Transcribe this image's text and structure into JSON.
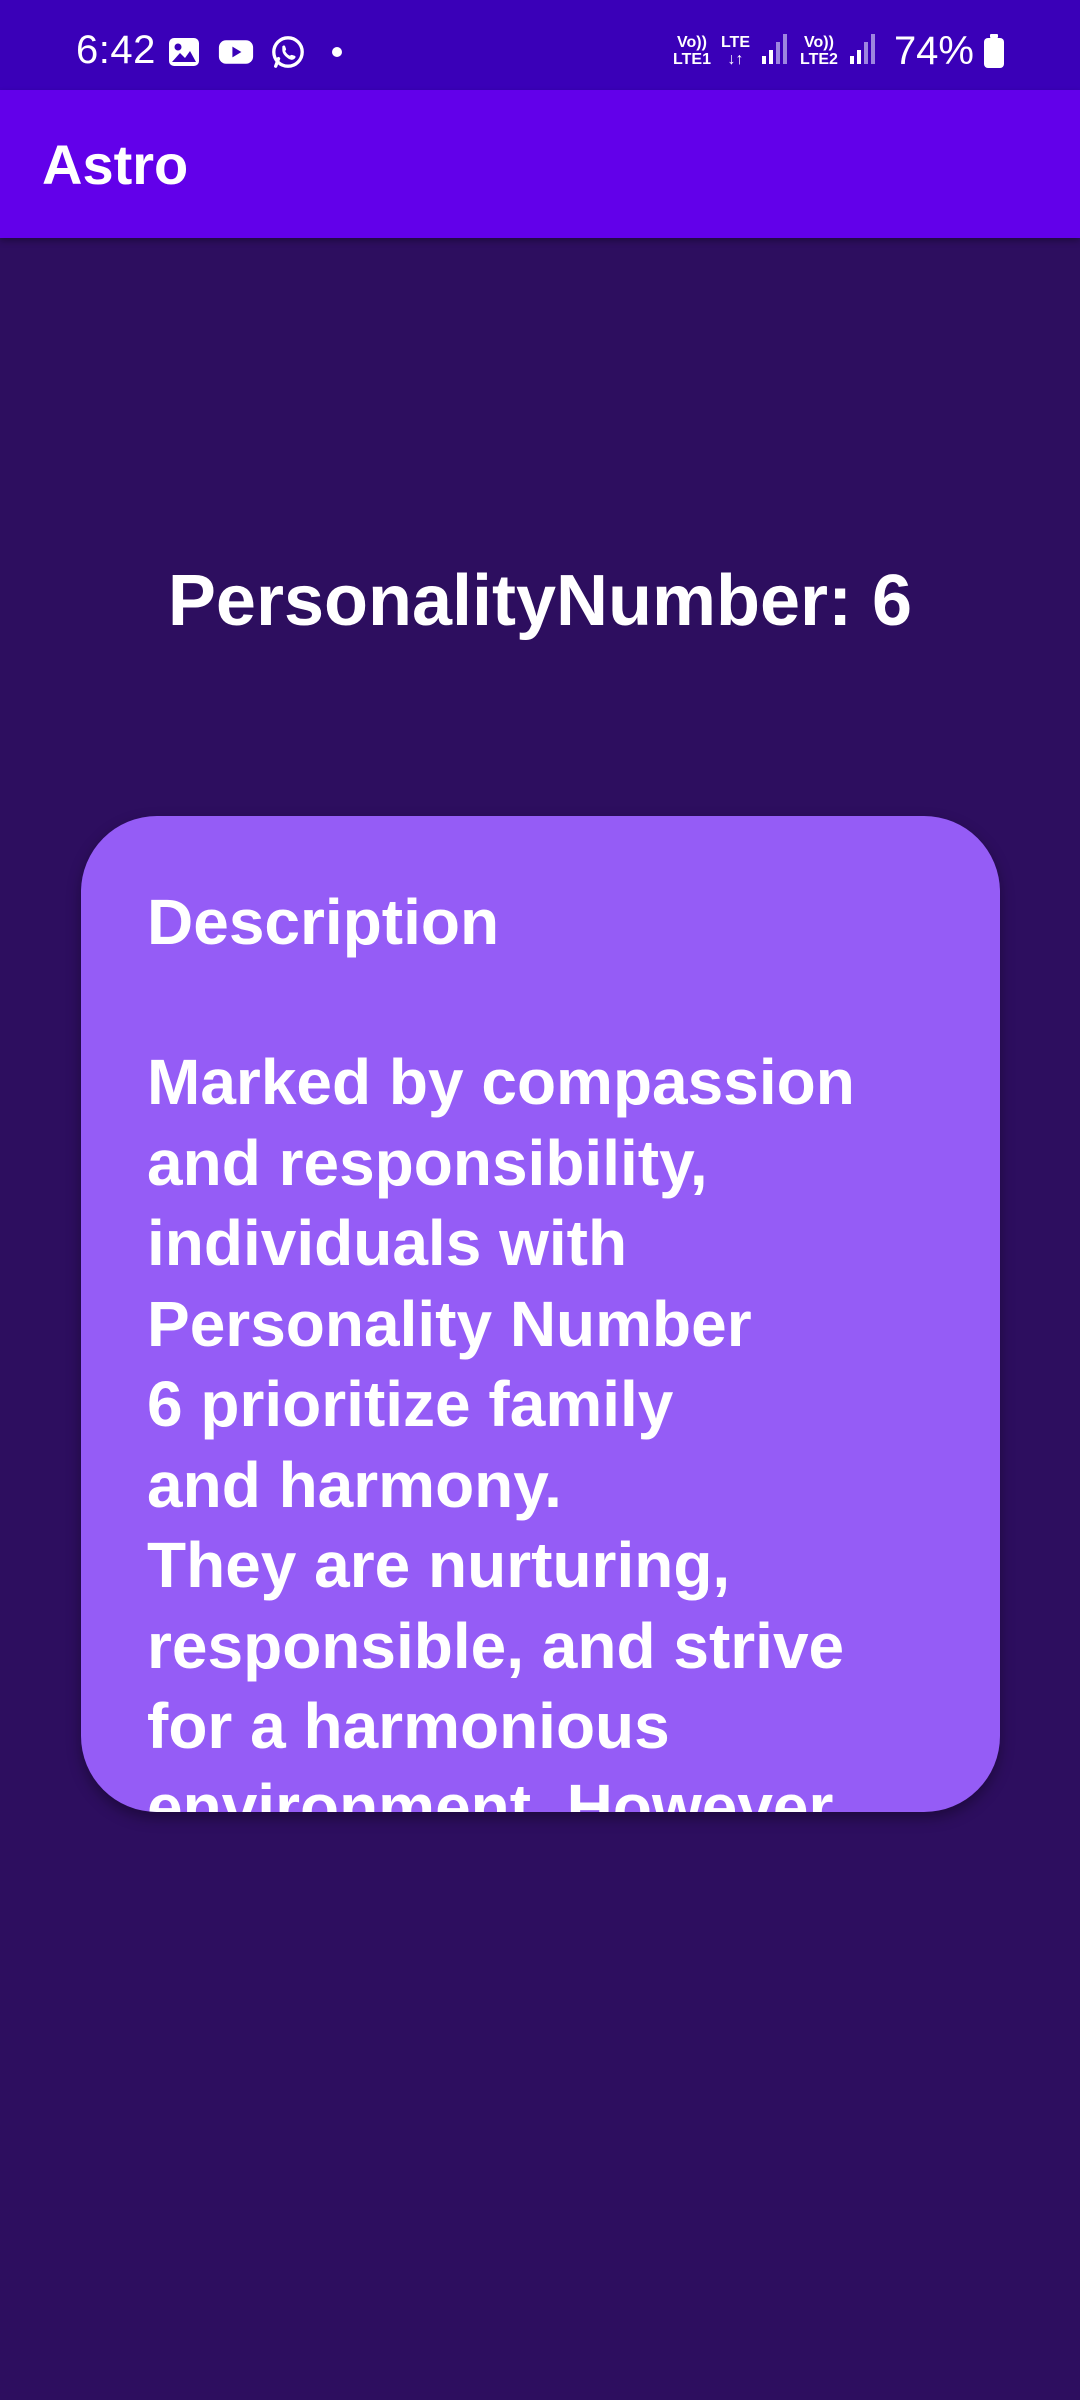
{
  "status_bar": {
    "time": "6:42",
    "left_icons": [
      "gallery-icon",
      "youtube-icon",
      "whatsapp-icon"
    ],
    "network1_top": "Vo))",
    "network1_bottom": "LTE1",
    "data_top": "LTE",
    "data_bottom": "↓↑",
    "network2_top": "Vo))",
    "network2_bottom": "LTE2",
    "battery": "74%"
  },
  "app_bar": {
    "title": "Astro"
  },
  "main": {
    "headline": "PersonalityNumber: 6"
  },
  "card": {
    "heading": "Description",
    "body": "Marked by compassion\nand responsibility,\nindividuals with\nPersonality Number\n6 prioritize family\nand harmony.\nThey are nurturing,\nresponsible, and strive\nfor a harmonious\nenvironment. However"
  },
  "colors": {
    "status_bar": "#3a00b8",
    "app_bar": "#6200ea",
    "background": "#2d0e5f",
    "card": "#955cf6",
    "text": "#ffffff"
  }
}
